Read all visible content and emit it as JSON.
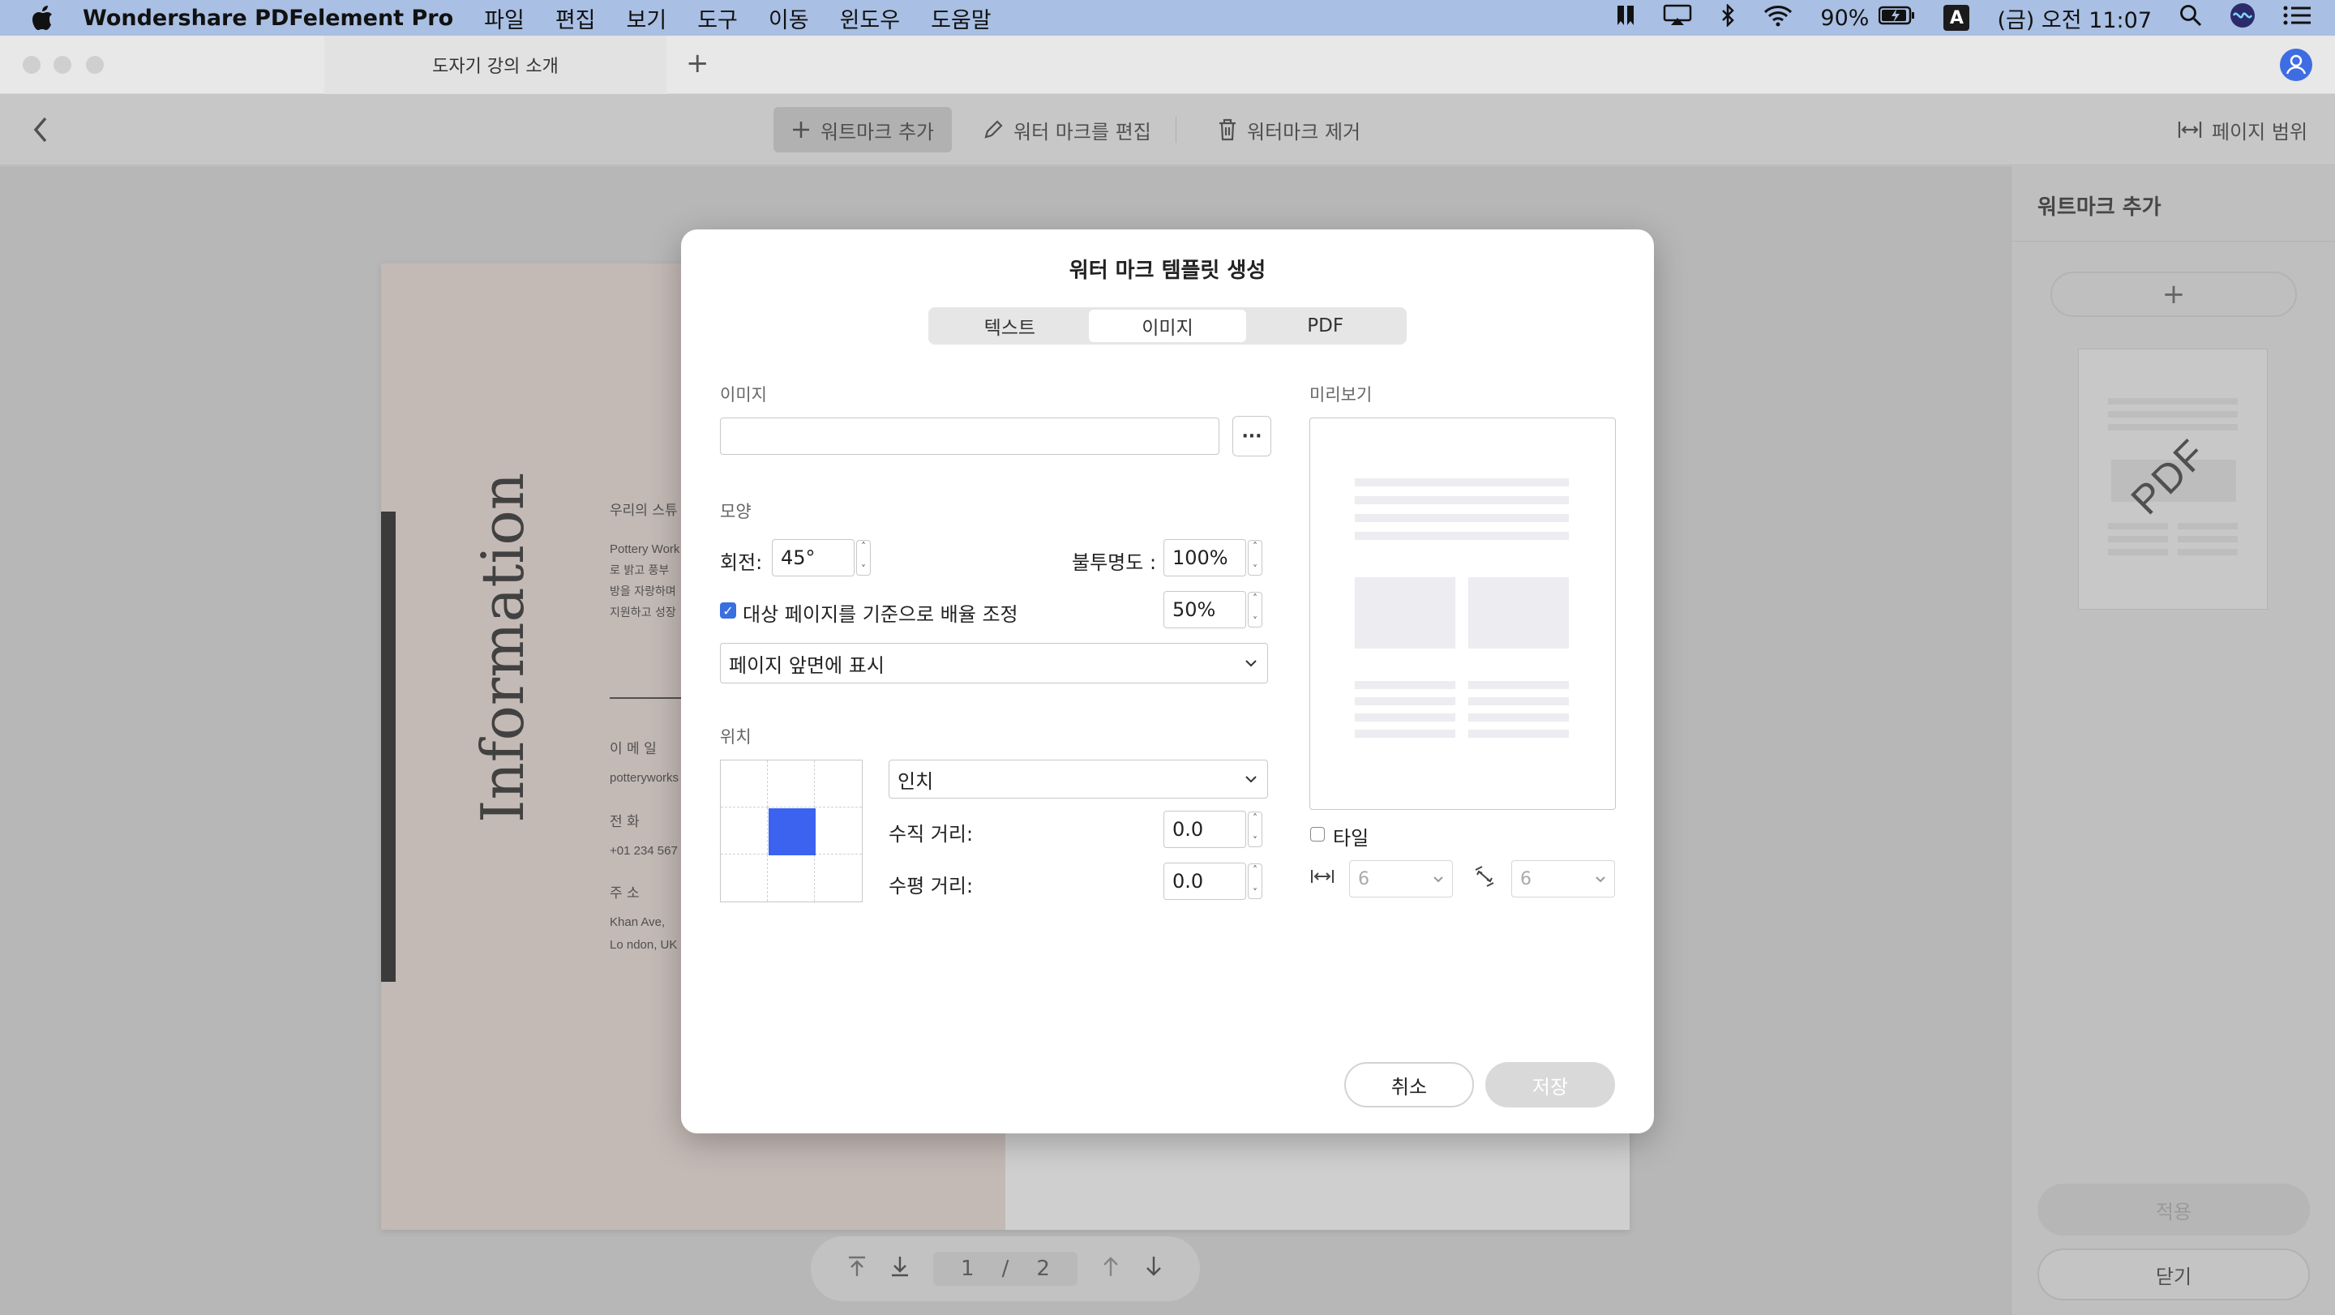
{
  "menubar": {
    "app_name": "Wondershare PDFelement Pro",
    "items": [
      "파일",
      "편집",
      "보기",
      "도구",
      "이동",
      "윈도우",
      "도움말"
    ],
    "battery": "90%",
    "input_source": "A",
    "clock": "(금) 오전 11:07"
  },
  "window": {
    "tab_title": "도자기 강의 소개",
    "new_tab": "+"
  },
  "toolbar": {
    "add_watermark": "워트마크 추가",
    "edit_watermark": "워터 마크를 편집",
    "remove_watermark": "워터마크 제거",
    "page_range": "페이지 범위"
  },
  "document": {
    "title": "Information",
    "lines": [
      "우리의 스튜",
      "Pottery Work",
      "로 밝고 풍부",
      "방을 자랑하며",
      "지원하고 성장"
    ],
    "email_label": "이 메 일",
    "email_value": "potteryworks",
    "phone_label": "전 화",
    "phone_value": "+01 234 567",
    "address_label": "주 소",
    "address_line1": "Khan Ave,",
    "address_line2": "Lo ndon, UK"
  },
  "page_nav": {
    "current": "1",
    "separator": "/",
    "total": "2"
  },
  "right_panel": {
    "title": "워트마크 추가",
    "add": "+",
    "thumb_text": "PDF",
    "apply": "적용",
    "close": "닫기"
  },
  "dialog": {
    "title": "워터 마크 템플릿 생성",
    "tabs": [
      "텍스트",
      "이미지",
      "PDF"
    ],
    "active_tab": 1,
    "image_section": "이미지",
    "image_path": "",
    "browse": "···",
    "shape_section": "모양",
    "rotation_label": "회전:",
    "rotation_value": "45°",
    "opacity_label": "불투명도 :",
    "opacity_value": "100%",
    "scale_checkbox_label": "대상 페이지를 기준으로 배율 조정",
    "scale_checked": true,
    "scale_value": "50%",
    "layer_select": "페이지 앞면에 표시",
    "position_section": "위치",
    "unit_select": "인치",
    "vertical_label": "수직 거리:",
    "vertical_value": "0.0",
    "horizontal_label": "수평 거리:",
    "horizontal_value": "0.0",
    "preview_section": "미리보기",
    "tile_label": "타일",
    "tile_checked": false,
    "tile_h_value": "6",
    "tile_v_value": "6",
    "cancel": "취소",
    "save": "저장"
  },
  "colors": {
    "accent": "#3b63f0",
    "menubar": "#a9bfe3",
    "page_pink": "#ecdcd6"
  }
}
